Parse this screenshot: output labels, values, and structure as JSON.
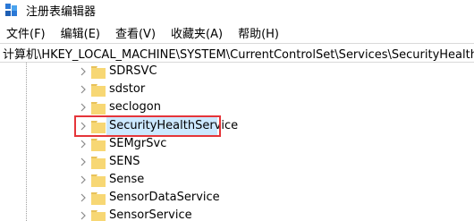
{
  "window": {
    "title": "注册表编辑器",
    "icon": "regedit-icon"
  },
  "menu": {
    "items": [
      "文件(F)",
      "编辑(E)",
      "查看(V)",
      "收藏夹(A)",
      "帮助(H)"
    ]
  },
  "address": {
    "path": "计算机\\HKEY_LOCAL_MACHINE\\SYSTEM\\CurrentControlSet\\Services\\SecurityHealthService"
  },
  "tree": {
    "nodes": [
      {
        "label": "SDRSVC",
        "selected": false
      },
      {
        "label": "sdstor",
        "selected": false
      },
      {
        "label": "seclogon",
        "selected": false
      },
      {
        "label": "SecurityHealthService",
        "selected": true
      },
      {
        "label": "SEMgrSvc",
        "selected": false
      },
      {
        "label": "SENS",
        "selected": false
      },
      {
        "label": "Sense",
        "selected": false
      },
      {
        "label": "SensorDataService",
        "selected": false
      },
      {
        "label": "SensorService",
        "selected": false
      }
    ]
  },
  "colors": {
    "highlight_border": "#e5353a",
    "selection_bg": "#cce8ff",
    "folder": "#f7d774"
  }
}
